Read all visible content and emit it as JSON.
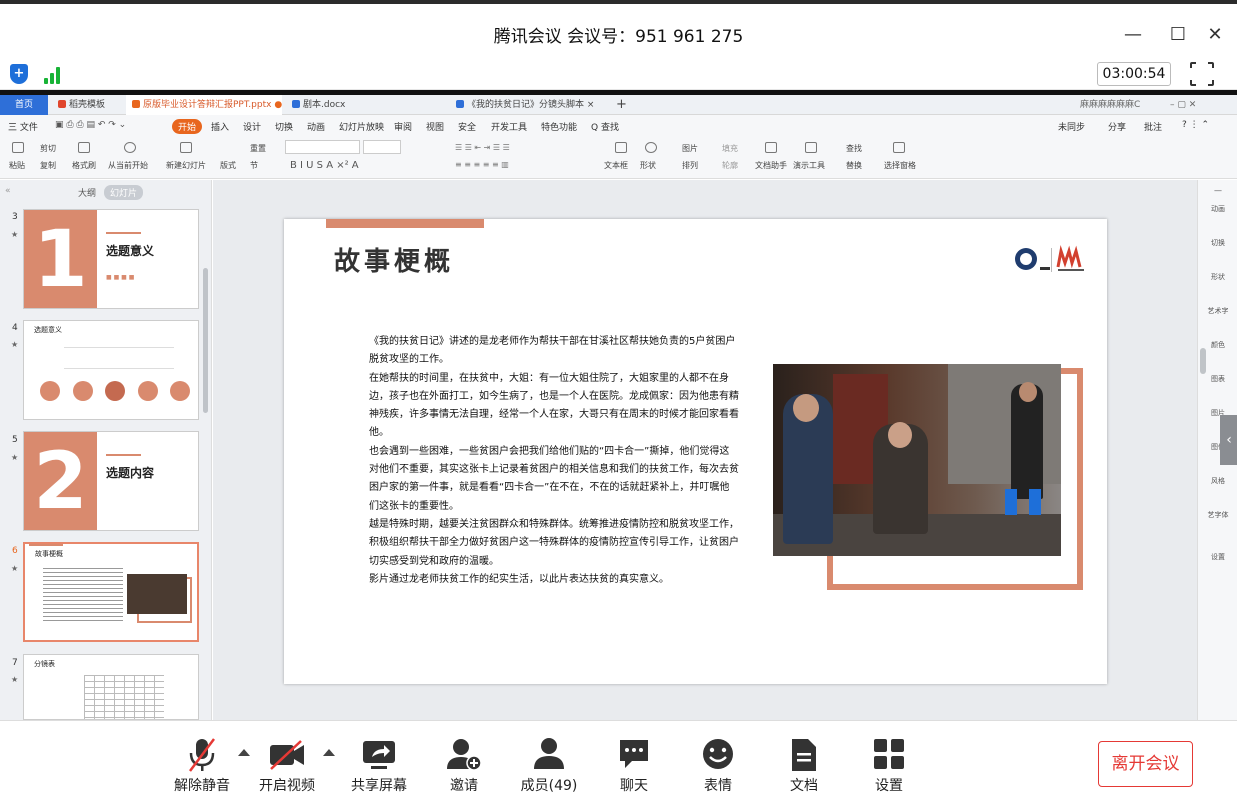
{
  "window": {
    "title": "腾讯会议 会议号：951 961 275",
    "timer": "03:00:54"
  },
  "tabs": [
    {
      "label": "首页"
    },
    {
      "label": "稻壳模板"
    },
    {
      "label": "原版毕业设计答辩汇报PPT.pptx"
    },
    {
      "label": "剧本.docx"
    },
    {
      "label": "《我的扶贫日记》分镜头脚本"
    }
  ],
  "account": "麻麻麻麻麻麻C",
  "menu": {
    "file": "三 文件",
    "items": [
      "开始",
      "插入",
      "设计",
      "切换",
      "动画",
      "幻灯片放映",
      "审阅",
      "视图",
      "安全",
      "开发工具",
      "特色功能",
      "Q 查找"
    ],
    "right": [
      "未同步",
      "分享",
      "批注"
    ]
  },
  "ribbon": {
    "paste": "粘贴",
    "cut": "剪切",
    "copy": "复制",
    "format_painter": "格式刷",
    "from_current": "从当前开始",
    "new_slide": "新建幻灯片",
    "layout": "版式",
    "reset": "重置",
    "section": "节",
    "textbox": "文本框",
    "shape": "形状",
    "picture": "图片",
    "arrange": "排列",
    "fill": "填充",
    "outline": "轮廓",
    "doc_helper": "文档助手",
    "presenter_tools": "演示工具",
    "find": "查找",
    "replace": "替换",
    "select_pane": "选择窗格"
  },
  "left_pane": {
    "outline_tab": "大纲",
    "slides_tab": "幻灯片",
    "thumbs": [
      {
        "num": "3",
        "title": "选题意义",
        "big": "1"
      },
      {
        "num": "4",
        "title": "选题意义"
      },
      {
        "num": "5",
        "title": "选题内容",
        "big": "2"
      },
      {
        "num": "6",
        "title": "故事梗概"
      },
      {
        "num": "7",
        "title": "分镜表"
      }
    ]
  },
  "slide": {
    "title": "故事梗概",
    "paragraphs": [
      "《我的扶贫日记》讲述的是龙老师作为帮扶干部在甘溪社区帮扶她负责的5户贫困户脱贫攻坚的工作。",
      "在她帮扶的时间里，在扶贫中，大姐：有一位大姐住院了，大姐家里的人都不在身边，孩子也在外面打工，如今生病了，也是一个人在医院。龙成佩家：因为他患有精神残疾，许多事情无法自理，经常一个人在家，大哥只有在周末的时候才能回家看看他。",
      "也会遇到一些困难，一些贫困户会把我们给他们贴的“四卡合一”撕掉，他们觉得这对他们不重要，其实这张卡上记录着贫困户的相关信息和我们的扶贫工作，每次去贫困户家的第一件事，就是看看“四卡合一”在不在，不在的话就赶紧补上，并叮嘱他们这张卡的重要性。",
      "越是特殊时期，越要关注贫困群众和特殊群体。统筹推进疫情防控和脱贫攻坚工作，积极组织帮扶干部全力做好贫困户这一特殊群体的疫情防控宣传引导工作，让贫困户切实感受到党和政府的温暖。",
      " 影片通过龙老师扶贫工作的纪实生活，以此片表达扶贫的真实意义。"
    ]
  },
  "right_bar": [
    "动画",
    "切换",
    "形状",
    "艺术字",
    "颜色",
    "图表",
    "图片",
    "图像",
    "风格",
    "艺字体",
    "设置"
  ],
  "bottom": {
    "unmute": "解除静音",
    "video": "开启视频",
    "share": "共享屏幕",
    "invite": "邀请",
    "members": "成员(49)",
    "chat": "聊天",
    "emoji": "表情",
    "docs": "文档",
    "settings": "设置",
    "leave": "离开会议"
  },
  "colors": {
    "accent": "#d98a6e",
    "leave": "#e53935",
    "wps_orange": "#e8661e",
    "home_tab": "#2e6fd8"
  }
}
